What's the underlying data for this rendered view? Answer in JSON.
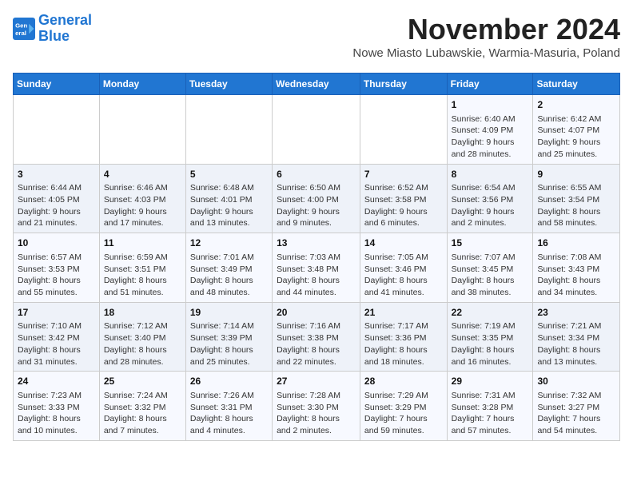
{
  "logo": {
    "line1": "General",
    "line2": "Blue"
  },
  "title": "November 2024",
  "location": "Nowe Miasto Lubawskie, Warmia-Masuria, Poland",
  "headers": [
    "Sunday",
    "Monday",
    "Tuesday",
    "Wednesday",
    "Thursday",
    "Friday",
    "Saturday"
  ],
  "weeks": [
    [
      {
        "day": "",
        "info": ""
      },
      {
        "day": "",
        "info": ""
      },
      {
        "day": "",
        "info": ""
      },
      {
        "day": "",
        "info": ""
      },
      {
        "day": "",
        "info": ""
      },
      {
        "day": "1",
        "info": "Sunrise: 6:40 AM\nSunset: 4:09 PM\nDaylight: 9 hours and 28 minutes."
      },
      {
        "day": "2",
        "info": "Sunrise: 6:42 AM\nSunset: 4:07 PM\nDaylight: 9 hours and 25 minutes."
      }
    ],
    [
      {
        "day": "3",
        "info": "Sunrise: 6:44 AM\nSunset: 4:05 PM\nDaylight: 9 hours and 21 minutes."
      },
      {
        "day": "4",
        "info": "Sunrise: 6:46 AM\nSunset: 4:03 PM\nDaylight: 9 hours and 17 minutes."
      },
      {
        "day": "5",
        "info": "Sunrise: 6:48 AM\nSunset: 4:01 PM\nDaylight: 9 hours and 13 minutes."
      },
      {
        "day": "6",
        "info": "Sunrise: 6:50 AM\nSunset: 4:00 PM\nDaylight: 9 hours and 9 minutes."
      },
      {
        "day": "7",
        "info": "Sunrise: 6:52 AM\nSunset: 3:58 PM\nDaylight: 9 hours and 6 minutes."
      },
      {
        "day": "8",
        "info": "Sunrise: 6:54 AM\nSunset: 3:56 PM\nDaylight: 9 hours and 2 minutes."
      },
      {
        "day": "9",
        "info": "Sunrise: 6:55 AM\nSunset: 3:54 PM\nDaylight: 8 hours and 58 minutes."
      }
    ],
    [
      {
        "day": "10",
        "info": "Sunrise: 6:57 AM\nSunset: 3:53 PM\nDaylight: 8 hours and 55 minutes."
      },
      {
        "day": "11",
        "info": "Sunrise: 6:59 AM\nSunset: 3:51 PM\nDaylight: 8 hours and 51 minutes."
      },
      {
        "day": "12",
        "info": "Sunrise: 7:01 AM\nSunset: 3:49 PM\nDaylight: 8 hours and 48 minutes."
      },
      {
        "day": "13",
        "info": "Sunrise: 7:03 AM\nSunset: 3:48 PM\nDaylight: 8 hours and 44 minutes."
      },
      {
        "day": "14",
        "info": "Sunrise: 7:05 AM\nSunset: 3:46 PM\nDaylight: 8 hours and 41 minutes."
      },
      {
        "day": "15",
        "info": "Sunrise: 7:07 AM\nSunset: 3:45 PM\nDaylight: 8 hours and 38 minutes."
      },
      {
        "day": "16",
        "info": "Sunrise: 7:08 AM\nSunset: 3:43 PM\nDaylight: 8 hours and 34 minutes."
      }
    ],
    [
      {
        "day": "17",
        "info": "Sunrise: 7:10 AM\nSunset: 3:42 PM\nDaylight: 8 hours and 31 minutes."
      },
      {
        "day": "18",
        "info": "Sunrise: 7:12 AM\nSunset: 3:40 PM\nDaylight: 8 hours and 28 minutes."
      },
      {
        "day": "19",
        "info": "Sunrise: 7:14 AM\nSunset: 3:39 PM\nDaylight: 8 hours and 25 minutes."
      },
      {
        "day": "20",
        "info": "Sunrise: 7:16 AM\nSunset: 3:38 PM\nDaylight: 8 hours and 22 minutes."
      },
      {
        "day": "21",
        "info": "Sunrise: 7:17 AM\nSunset: 3:36 PM\nDaylight: 8 hours and 18 minutes."
      },
      {
        "day": "22",
        "info": "Sunrise: 7:19 AM\nSunset: 3:35 PM\nDaylight: 8 hours and 16 minutes."
      },
      {
        "day": "23",
        "info": "Sunrise: 7:21 AM\nSunset: 3:34 PM\nDaylight: 8 hours and 13 minutes."
      }
    ],
    [
      {
        "day": "24",
        "info": "Sunrise: 7:23 AM\nSunset: 3:33 PM\nDaylight: 8 hours and 10 minutes."
      },
      {
        "day": "25",
        "info": "Sunrise: 7:24 AM\nSunset: 3:32 PM\nDaylight: 8 hours and 7 minutes."
      },
      {
        "day": "26",
        "info": "Sunrise: 7:26 AM\nSunset: 3:31 PM\nDaylight: 8 hours and 4 minutes."
      },
      {
        "day": "27",
        "info": "Sunrise: 7:28 AM\nSunset: 3:30 PM\nDaylight: 8 hours and 2 minutes."
      },
      {
        "day": "28",
        "info": "Sunrise: 7:29 AM\nSunset: 3:29 PM\nDaylight: 7 hours and 59 minutes."
      },
      {
        "day": "29",
        "info": "Sunrise: 7:31 AM\nSunset: 3:28 PM\nDaylight: 7 hours and 57 minutes."
      },
      {
        "day": "30",
        "info": "Sunrise: 7:32 AM\nSunset: 3:27 PM\nDaylight: 7 hours and 54 minutes."
      }
    ]
  ]
}
